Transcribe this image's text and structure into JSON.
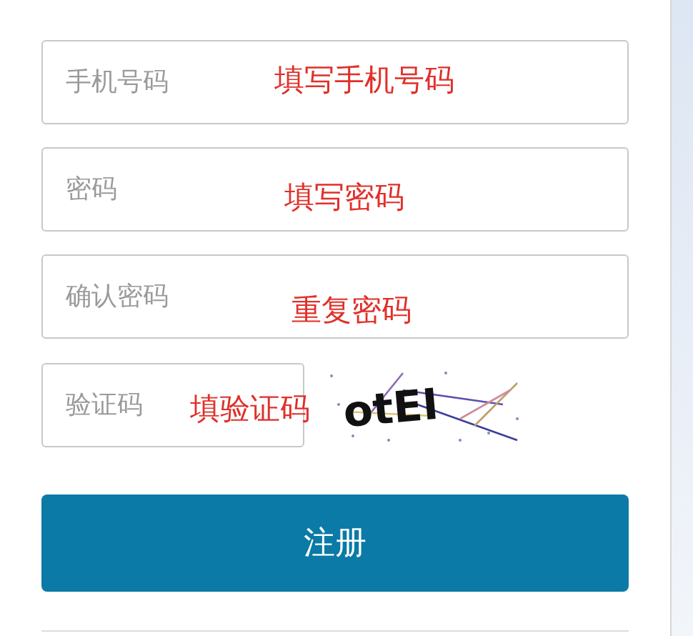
{
  "fields": [
    {
      "placeholder": "手机号码",
      "note": "填写手机号码"
    },
    {
      "placeholder": "密码",
      "note": "填写密码"
    },
    {
      "placeholder": "确认密码",
      "note": "重复密码"
    }
  ],
  "captcha": {
    "placeholder": "验证码",
    "note": "填验证码",
    "code": "otEI"
  },
  "submit": "注册"
}
